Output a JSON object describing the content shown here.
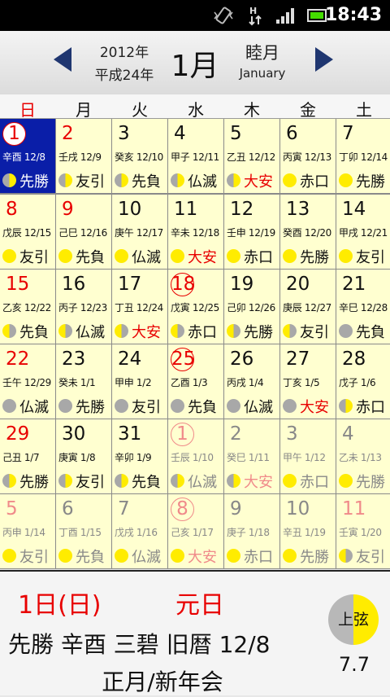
{
  "status": {
    "time": "18:43"
  },
  "header": {
    "year": "2012年",
    "era": "平成24年",
    "month": "1月",
    "jp_month": "睦月",
    "en_month": "January"
  },
  "weekdays": [
    {
      "label": "日",
      "color": "#e80000"
    },
    {
      "label": "月",
      "color": "#111111"
    },
    {
      "label": "火",
      "color": "#111111"
    },
    {
      "label": "水",
      "color": "#111111"
    },
    {
      "label": "木",
      "color": "#111111"
    },
    {
      "label": "金",
      "color": "#111111"
    },
    {
      "label": "土",
      "color": "#111111"
    }
  ],
  "days": [
    {
      "day": "1",
      "lunar": "辛酉 12/8",
      "rokuyo": "先勝",
      "moon": "ql",
      "cur": true,
      "red": true,
      "circle": true,
      "selected": true
    },
    {
      "day": "2",
      "lunar": "壬戌 12/9",
      "rokuyo": "友引",
      "moon": "ql",
      "cur": true,
      "red": true
    },
    {
      "day": "3",
      "lunar": "癸亥 12/10",
      "rokuyo": "先負",
      "moon": "ql",
      "cur": true
    },
    {
      "day": "4",
      "lunar": "甲子 12/11",
      "rokuyo": "仏滅",
      "moon": "ql",
      "cur": true
    },
    {
      "day": "5",
      "lunar": "乙丑 12/12",
      "rokuyo": "大安",
      "moon": "ql",
      "cur": true,
      "rokuyo_red": true
    },
    {
      "day": "6",
      "lunar": "丙寅 12/13",
      "rokuyo": "赤口",
      "moon": "full",
      "cur": true
    },
    {
      "day": "7",
      "lunar": "丁卯 12/14",
      "rokuyo": "先勝",
      "moon": "full",
      "cur": true
    },
    {
      "day": "8",
      "lunar": "戊辰 12/15",
      "rokuyo": "友引",
      "moon": "full",
      "cur": true,
      "red": true
    },
    {
      "day": "9",
      "lunar": "己巳 12/16",
      "rokuyo": "先負",
      "moon": "full",
      "cur": true,
      "red": true
    },
    {
      "day": "10",
      "lunar": "庚午 12/17",
      "rokuyo": "仏滅",
      "moon": "full",
      "cur": true
    },
    {
      "day": "11",
      "lunar": "辛未 12/18",
      "rokuyo": "大安",
      "moon": "full",
      "cur": true,
      "rokuyo_red": true
    },
    {
      "day": "12",
      "lunar": "壬申 12/19",
      "rokuyo": "赤口",
      "moon": "full",
      "cur": true
    },
    {
      "day": "13",
      "lunar": "癸酉 12/20",
      "rokuyo": "先勝",
      "moon": "full",
      "cur": true
    },
    {
      "day": "14",
      "lunar": "甲戌 12/21",
      "rokuyo": "友引",
      "moon": "full",
      "cur": true
    },
    {
      "day": "15",
      "lunar": "乙亥 12/22",
      "rokuyo": "先負",
      "moon": "qr",
      "cur": true,
      "red": true
    },
    {
      "day": "16",
      "lunar": "丙子 12/23",
      "rokuyo": "仏滅",
      "moon": "qr",
      "cur": true
    },
    {
      "day": "17",
      "lunar": "丁丑 12/24",
      "rokuyo": "大安",
      "moon": "qr",
      "cur": true,
      "rokuyo_red": true
    },
    {
      "day": "18",
      "lunar": "戊寅 12/25",
      "rokuyo": "赤口",
      "moon": "qr",
      "cur": true,
      "red": true,
      "circle": true
    },
    {
      "day": "19",
      "lunar": "己卯 12/26",
      "rokuyo": "先勝",
      "moon": "qr",
      "cur": true
    },
    {
      "day": "20",
      "lunar": "庚辰 12/27",
      "rokuyo": "友引",
      "moon": "qr",
      "cur": true
    },
    {
      "day": "21",
      "lunar": "辛巳 12/28",
      "rokuyo": "先負",
      "moon": "new",
      "cur": true
    },
    {
      "day": "22",
      "lunar": "壬午 12/29",
      "rokuyo": "仏滅",
      "moon": "new",
      "cur": true,
      "red": true
    },
    {
      "day": "23",
      "lunar": "癸未 1/1",
      "rokuyo": "先勝",
      "moon": "new",
      "cur": true
    },
    {
      "day": "24",
      "lunar": "甲申 1/2",
      "rokuyo": "友引",
      "moon": "new",
      "cur": true
    },
    {
      "day": "25",
      "lunar": "乙酉 1/3",
      "rokuyo": "先負",
      "moon": "new",
      "cur": true,
      "red": true,
      "circle": true
    },
    {
      "day": "26",
      "lunar": "丙戌 1/4",
      "rokuyo": "仏滅",
      "moon": "new",
      "cur": true
    },
    {
      "day": "27",
      "lunar": "丁亥 1/5",
      "rokuyo": "大安",
      "moon": "new",
      "cur": true,
      "rokuyo_red": true
    },
    {
      "day": "28",
      "lunar": "戊子 1/6",
      "rokuyo": "赤口",
      "moon": "ql",
      "cur": true
    },
    {
      "day": "29",
      "lunar": "己丑 1/7",
      "rokuyo": "先勝",
      "moon": "ql",
      "cur": true,
      "red": true
    },
    {
      "day": "30",
      "lunar": "庚寅 1/8",
      "rokuyo": "友引",
      "moon": "ql",
      "cur": true
    },
    {
      "day": "31",
      "lunar": "辛卯 1/9",
      "rokuyo": "先負",
      "moon": "ql",
      "cur": true
    },
    {
      "day": "1",
      "lunar": "壬辰 1/10",
      "rokuyo": "仏滅",
      "moon": "ql",
      "cur": false,
      "red": true,
      "circle": true
    },
    {
      "day": "2",
      "lunar": "癸巳 1/11",
      "rokuyo": "大安",
      "moon": "ql",
      "cur": false,
      "rokuyo_red": true
    },
    {
      "day": "3",
      "lunar": "甲午 1/12",
      "rokuyo": "赤口",
      "moon": "full",
      "cur": false
    },
    {
      "day": "4",
      "lunar": "乙未 1/13",
      "rokuyo": "先勝",
      "moon": "full",
      "cur": false
    },
    {
      "day": "5",
      "lunar": "丙申 1/14",
      "rokuyo": "友引",
      "moon": "full",
      "cur": false,
      "red": true
    },
    {
      "day": "6",
      "lunar": "丁酉 1/15",
      "rokuyo": "先負",
      "moon": "full",
      "cur": false
    },
    {
      "day": "7",
      "lunar": "戊戌 1/16",
      "rokuyo": "仏滅",
      "moon": "full",
      "cur": false
    },
    {
      "day": "8",
      "lunar": "己亥 1/17",
      "rokuyo": "大安",
      "moon": "full",
      "cur": false,
      "red": true,
      "circle": true,
      "rokuyo_red": true
    },
    {
      "day": "9",
      "lunar": "庚子 1/18",
      "rokuyo": "赤口",
      "moon": "full",
      "cur": false
    },
    {
      "day": "10",
      "lunar": "辛丑 1/19",
      "rokuyo": "先勝",
      "moon": "full",
      "cur": false
    },
    {
      "day": "11",
      "lunar": "壬寅 1/20",
      "rokuyo": "友引",
      "moon": "qr",
      "cur": false,
      "red": true
    }
  ],
  "footer": {
    "date": "1日(日)",
    "holiday": "元日",
    "info": "先勝 辛酉 三碧 旧暦 12/8",
    "event": "正月/新年会",
    "moon_phase": "上弦",
    "moon_age": "7.7"
  },
  "colors": {
    "cell_bg": "#ffffd0",
    "selected_bg": "#0a1ea8",
    "holiday_red": "#e80000",
    "other_month_gray": "#888888"
  }
}
